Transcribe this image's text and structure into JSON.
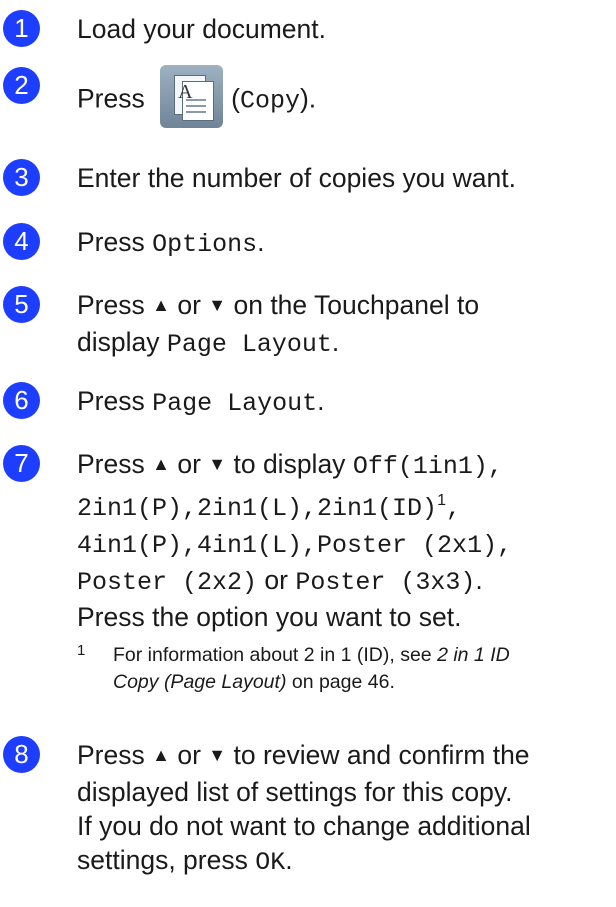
{
  "steps": [
    {
      "n": "1",
      "text": "Load your document."
    },
    {
      "n": "2",
      "before": "Press",
      "after_open": "(",
      "mono": "Copy",
      "after_close": ")."
    },
    {
      "n": "3",
      "text": "Enter the number of copies you want."
    },
    {
      "n": "4",
      "before": "Press ",
      "mono": "Options",
      "after": "."
    },
    {
      "n": "5",
      "line1": "Press",
      "or": "or",
      "line1_end": "on the Touchpanel to",
      "line2_a": "display ",
      "line2_mono": "Page Layout",
      "line2_end": "."
    },
    {
      "n": "6",
      "before": "Press ",
      "mono": "Page Layout",
      "after": "."
    },
    {
      "n": "7",
      "line1_a": "Press",
      "or": "or",
      "line1_b": "to display ",
      "line1_mono": "Off(1in1),",
      "line2_mono": "2in1(P),2in1(L),2in1(ID)",
      "line2_sup": "1",
      "line2_end": ",",
      "line3_mono": "4in1(P),4in1(L),Poster (2x1),",
      "line4_mono1": "Poster (2x2)",
      "line4_or": "or",
      "line4_mono2": "Poster (3x3)",
      "line4_end": ".",
      "line5": "Press the option you want to set."
    },
    {
      "n": "8",
      "line1_a": "Press",
      "or": "or",
      "line1_b": "to review and confirm the",
      "line2": "displayed list of settings for this copy.",
      "line3": "If you do not want to change additional",
      "line4_a": "settings, press ",
      "line4_mono": "OK",
      "line4_end": "."
    }
  ],
  "footnote": {
    "mark": "1",
    "line1_a": "For information about 2 in 1 (ID), see ",
    "line1_italic": "2 in 1 ID",
    "line2_italic": "Copy (Page Layout)",
    "line2_end": " on page 46."
  },
  "icons": {
    "up": "▲",
    "down": "▼"
  }
}
